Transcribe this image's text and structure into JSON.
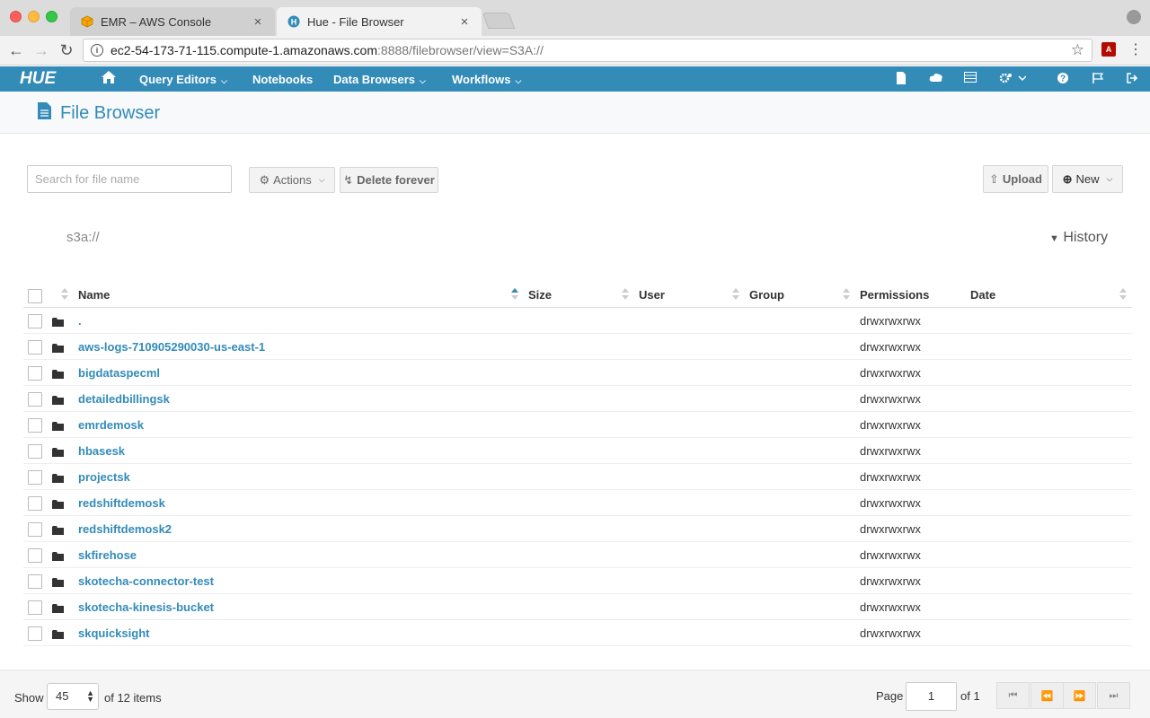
{
  "browser": {
    "tabs": [
      {
        "label": "EMR – AWS Console",
        "favicon": "aws-box-icon"
      },
      {
        "label": "Hue - File Browser",
        "favicon": "hue-icon"
      }
    ],
    "url_host": "ec2-54-173-71-115.compute-1.amazonaws.com",
    "url_rest": ":8888/filebrowser/view=S3A://",
    "tab_close": "×",
    "star": "☆",
    "pdf": "A",
    "menu_dots": "⋮"
  },
  "hue_nav": {
    "logo": "HUE",
    "items": [
      {
        "label": "Query Editors",
        "caret": true
      },
      {
        "label": "Notebooks",
        "caret": false
      },
      {
        "label": "Data Browsers",
        "caret": true
      },
      {
        "label": "Workflows",
        "caret": true
      }
    ],
    "right_icons": [
      "document-icon",
      "cloud-icon",
      "table-icon",
      "gears-icon",
      "help-icon",
      "flag-icon",
      "logout-icon"
    ]
  },
  "page": {
    "title": "File Browser"
  },
  "actions": {
    "search_placeholder": "Search for file name",
    "actions_label": "Actions",
    "delete_label": "Delete forever",
    "upload_label": "Upload",
    "new_label": "New"
  },
  "breadcrumb": "s3a://",
  "history_label": "History",
  "table": {
    "headers": {
      "name": "Name",
      "size": "Size",
      "user": "User",
      "group": "Group",
      "permissions": "Permissions",
      "date": "Date"
    },
    "rows": [
      {
        "name": ".",
        "permissions": "drwxrwxrwx"
      },
      {
        "name": "aws-logs-710905290030-us-east-1",
        "permissions": "drwxrwxrwx"
      },
      {
        "name": "bigdataspecml",
        "permissions": "drwxrwxrwx"
      },
      {
        "name": "detailedbillingsk",
        "permissions": "drwxrwxrwx"
      },
      {
        "name": "emrdemosk",
        "permissions": "drwxrwxrwx"
      },
      {
        "name": "hbasesk",
        "permissions": "drwxrwxrwx"
      },
      {
        "name": "projectsk",
        "permissions": "drwxrwxrwx"
      },
      {
        "name": "redshiftdemosk",
        "permissions": "drwxrwxrwx"
      },
      {
        "name": "redshiftdemosk2",
        "permissions": "drwxrwxrwx"
      },
      {
        "name": "skfirehose",
        "permissions": "drwxrwxrwx"
      },
      {
        "name": "skotecha-connector-test",
        "permissions": "drwxrwxrwx"
      },
      {
        "name": "skotecha-kinesis-bucket",
        "permissions": "drwxrwxrwx"
      },
      {
        "name": "skquicksight",
        "permissions": "drwxrwxrwx"
      }
    ]
  },
  "footer": {
    "show_label": "Show",
    "page_size": "45",
    "items_label": "of 12 items",
    "page_label": "Page",
    "page_value": "1",
    "of_label": "of 1"
  },
  "colors": {
    "hue_blue": "#338bb8"
  }
}
